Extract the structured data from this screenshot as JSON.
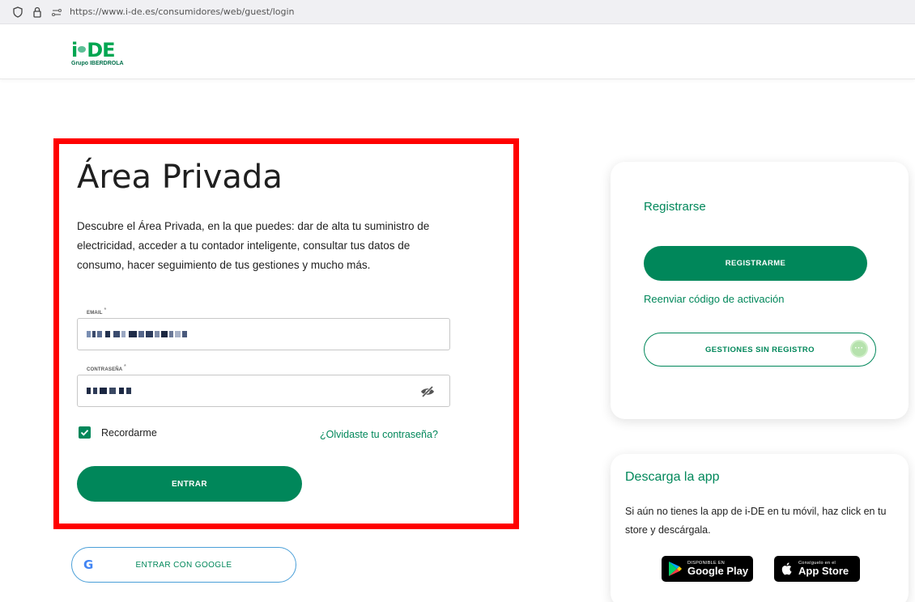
{
  "browser": {
    "url": "https://www.i-de.es/consumidores/web/guest/login"
  },
  "header": {
    "logo_main_left": "i",
    "logo_main_right": "DE",
    "logo_sub": "Grupo IBERDROLA"
  },
  "login": {
    "title": "Área Privada",
    "description": "Descubre el Área Privada, en la que puedes: dar de alta tu suministro de electricidad, acceder a tu contador inteligente, consultar tus datos de consumo, hacer seguimiento de tus gestiones y mucho más.",
    "email_label": "EMAIL",
    "password_label": "CONTRASEÑA",
    "required_mark": "*",
    "remember_label": "Recordarme",
    "remember_checked": true,
    "forgot_link": "¿Olvidaste tu contraseña?",
    "submit_label": "ENTRAR",
    "google_label": "ENTRAR CON GOOGLE",
    "google_icon_glyph": "G"
  },
  "register": {
    "title": "Registrarse",
    "register_button": "REGISTRARME",
    "resend_link": "Reenviar código de activación",
    "no_register_button": "GESTIONES SIN REGISTRO",
    "more_glyph": "···"
  },
  "app_download": {
    "title": "Descarga la app",
    "description": "Si aún no tienes la app de i-DE en tu móvil, haz click en tu store y descárgala.",
    "google_play_small": "DISPONIBLE EN",
    "google_play_big": "Google Play",
    "app_store_small": "Consíguelo en el",
    "app_store_big": "App Store"
  },
  "colors": {
    "brand_green": "#00875a",
    "highlight_border": "#ff0000",
    "google_border": "#4a9fd8"
  },
  "icons": [
    "shield-icon",
    "lock-icon",
    "site-info-icon",
    "eye-off-icon",
    "check-icon",
    "google-icon",
    "more-icon",
    "google-play-icon",
    "apple-icon"
  ]
}
